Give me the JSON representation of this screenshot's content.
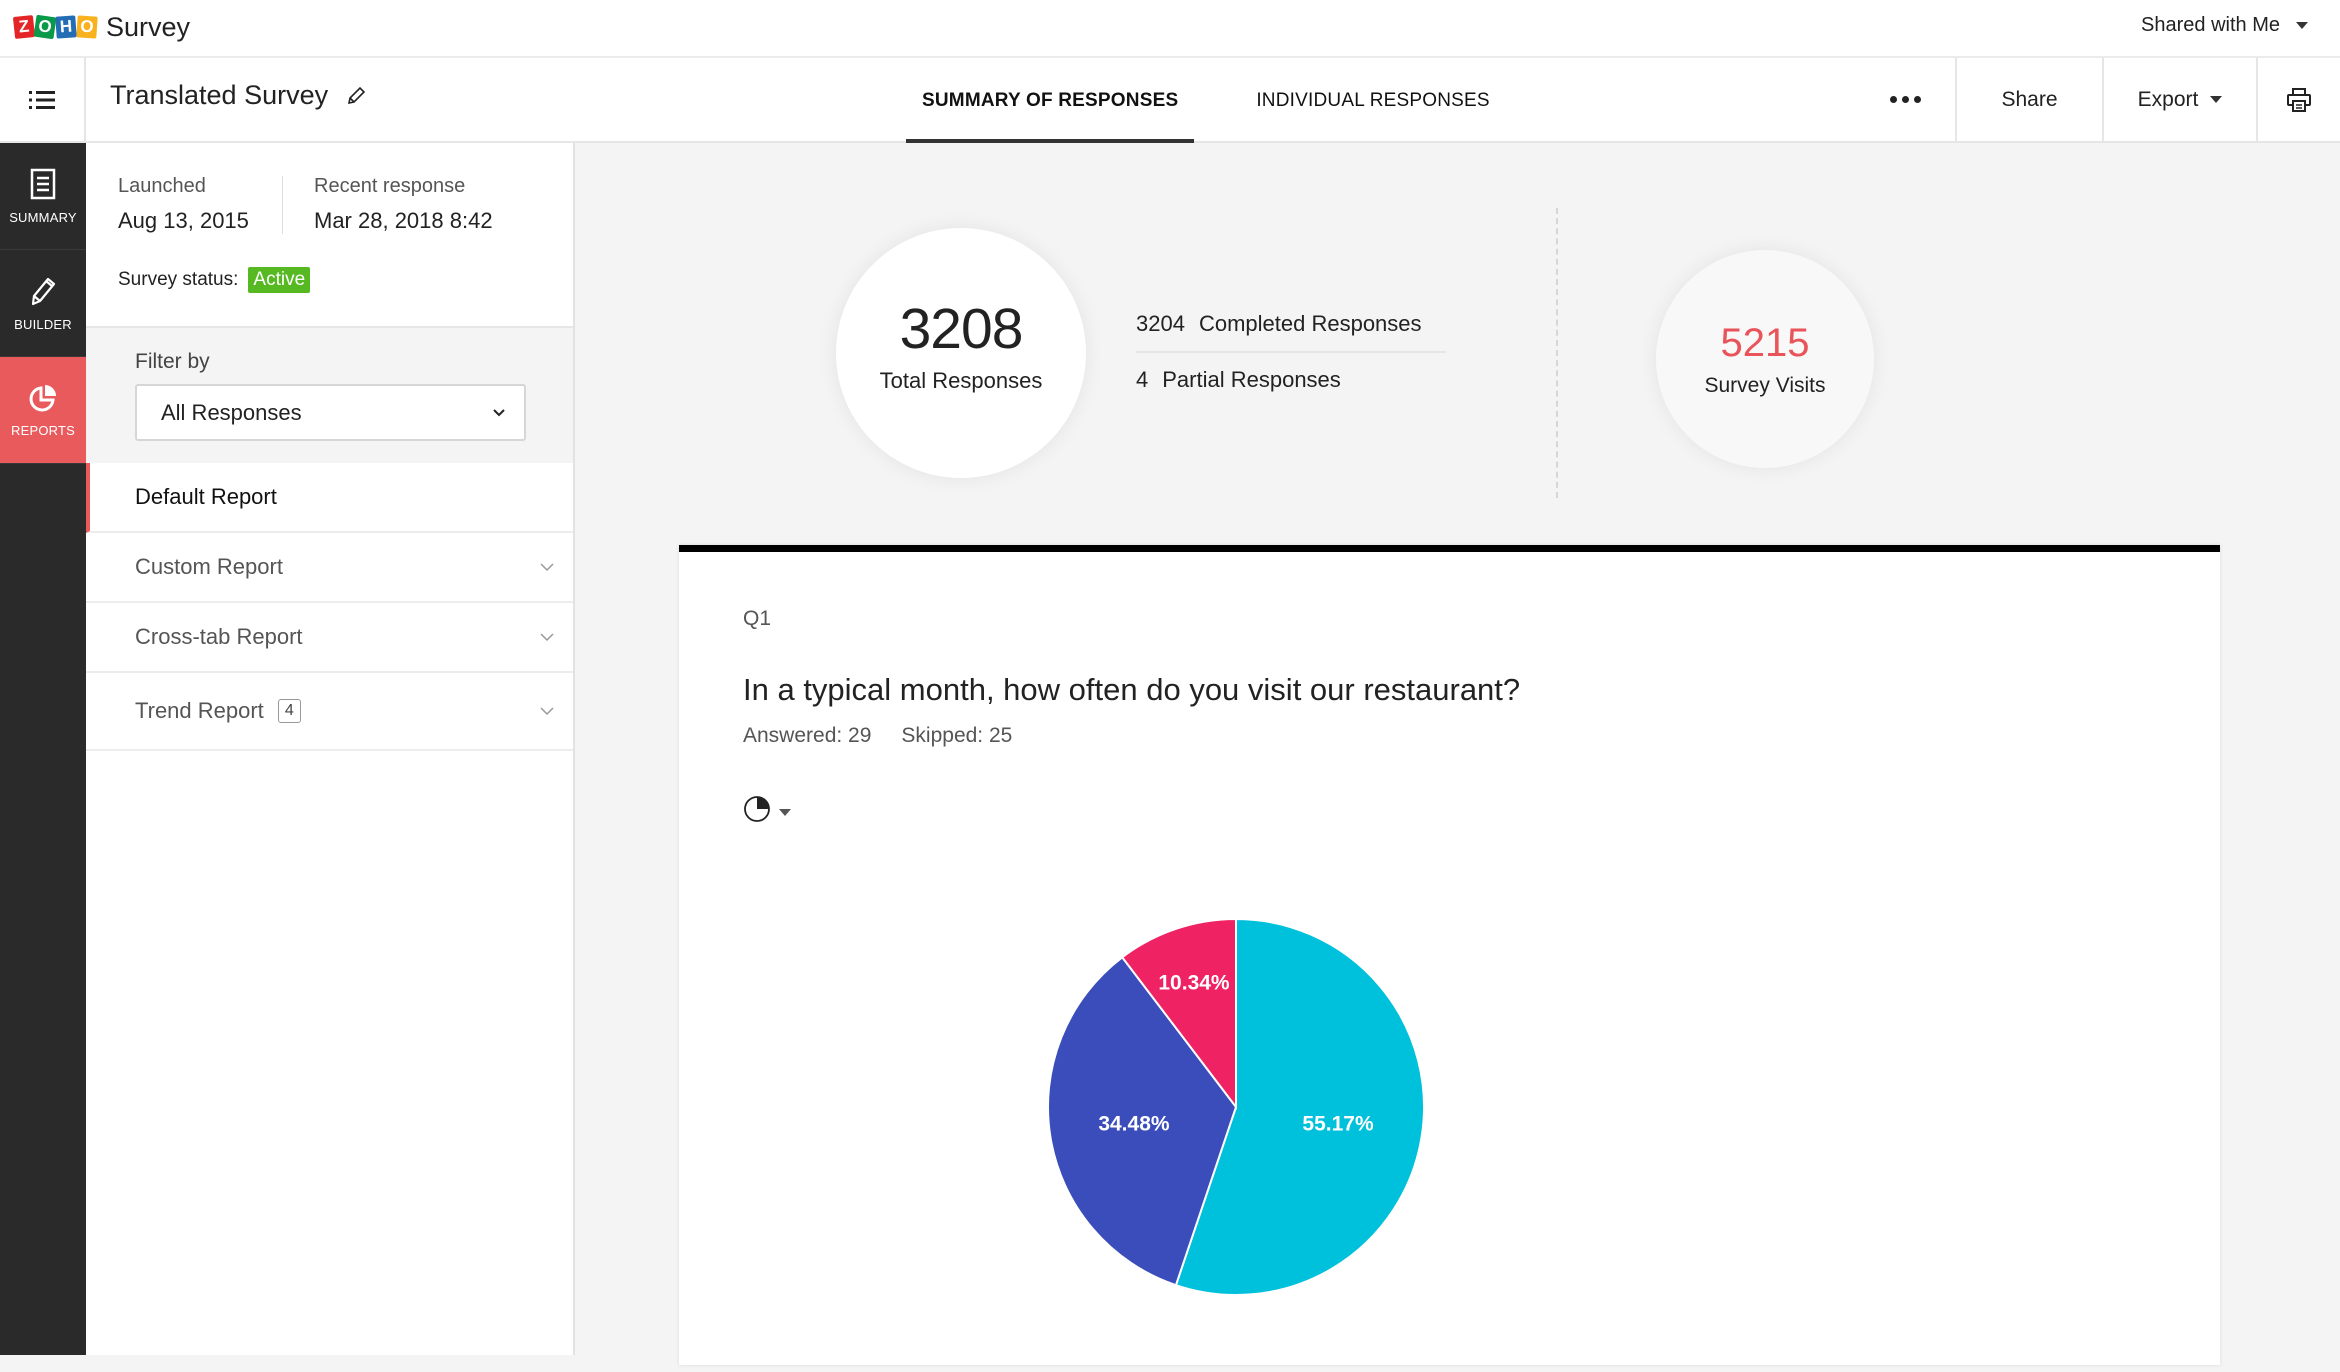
{
  "app": {
    "logo_letters": [
      "Z",
      "O",
      "H",
      "O"
    ],
    "brand": "Survey",
    "shared_menu": "Shared with Me"
  },
  "header": {
    "survey_title": "Translated Survey",
    "tabs": [
      {
        "label": "SUMMARY OF RESPONSES",
        "active": true
      },
      {
        "label": "INDIVIDUAL RESPONSES",
        "active": false
      }
    ],
    "share_label": "Share",
    "export_label": "Export"
  },
  "sidebar": {
    "items": [
      {
        "label": "SUMMARY",
        "icon": "document-icon"
      },
      {
        "label": "BUILDER",
        "icon": "pencil-icon"
      },
      {
        "label": "REPORTS",
        "icon": "pie-chart-icon",
        "active": true
      }
    ]
  },
  "panel": {
    "launched_label": "Launched",
    "launched_value": "Aug 13, 2015",
    "recent_label": "Recent response",
    "recent_value": "Mar 28, 2018 8:42",
    "status_label": "Survey status:",
    "status_value": "Active",
    "filter_label": "Filter by",
    "filter_value": "All Responses",
    "reports": [
      {
        "label": "Default Report",
        "active": true
      },
      {
        "label": "Custom Report"
      },
      {
        "label": "Cross-tab Report"
      },
      {
        "label": "Trend Report",
        "count": "4"
      }
    ]
  },
  "stats": {
    "total_value": "3208",
    "total_label": "Total Responses",
    "completed_value": "3204",
    "completed_label": "Completed Responses",
    "partial_value": "4",
    "partial_label": "Partial Responses",
    "visits_value": "5215",
    "visits_label": "Survey Visits"
  },
  "question": {
    "number": "Q1",
    "text": "In a typical month, how often do you visit our restaurant?",
    "answered": "Answered: 29",
    "skipped": "Skipped: 25"
  },
  "colors": {
    "accent": "#e95a5d",
    "active_badge": "#56b922",
    "visits": "#e9545a"
  },
  "chart_data": {
    "type": "pie",
    "title": "",
    "slices": [
      {
        "label": "55.17%",
        "value": 55.17,
        "color": "#00c1db"
      },
      {
        "label": "34.48%",
        "value": 34.48,
        "color": "#3a4dbb"
      },
      {
        "label": "10.34%",
        "value": 10.34,
        "color": "#ef2363"
      }
    ],
    "start": "top",
    "direction": "clockwise",
    "legend": "none"
  }
}
